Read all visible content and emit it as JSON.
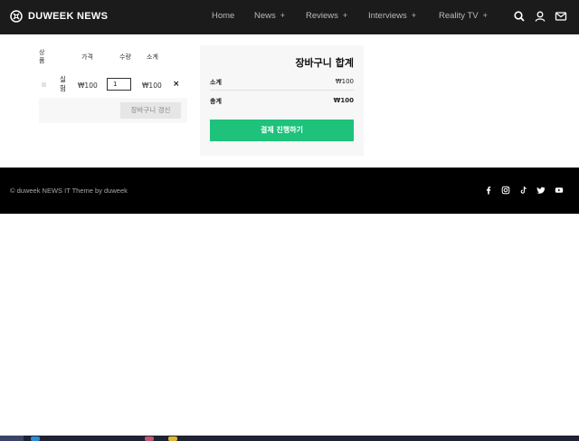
{
  "header": {
    "logo_text": "DUWEEK NEWS",
    "nav": [
      {
        "label": "Home",
        "has_submenu": false
      },
      {
        "label": "News",
        "has_submenu": true
      },
      {
        "label": "Reviews",
        "has_submenu": true
      },
      {
        "label": "Interviews",
        "has_submenu": true
      },
      {
        "label": "Reality TV",
        "has_submenu": true
      }
    ],
    "submenu_symbol": "+",
    "icons": [
      "search-icon",
      "user-icon",
      "mail-icon"
    ]
  },
  "cart": {
    "headers": {
      "product": "상품",
      "price": "가격",
      "quantity": "수량",
      "subtotal": "소계"
    },
    "items": [
      {
        "name": "실험",
        "price": "₩100",
        "quantity": "1",
        "subtotal": "₩100",
        "remove": "×"
      }
    ],
    "update_label": "장바구니 갱신"
  },
  "totals": {
    "title": "장바구니 합계",
    "subtotal_label": "소계",
    "subtotal_value": "₩100",
    "total_label": "총계",
    "total_value": "₩100",
    "checkout_label": "결제 진행하기"
  },
  "footer": {
    "copyright": "© duweek NEWS IT Theme by duweek",
    "social_icons": [
      "facebook-icon",
      "instagram-icon",
      "tiktok-icon",
      "twitter-icon",
      "youtube-icon"
    ]
  },
  "colors": {
    "header_bg": "#1b1b1b",
    "accent": "#1ec27a",
    "footer_bg": "#000000"
  }
}
